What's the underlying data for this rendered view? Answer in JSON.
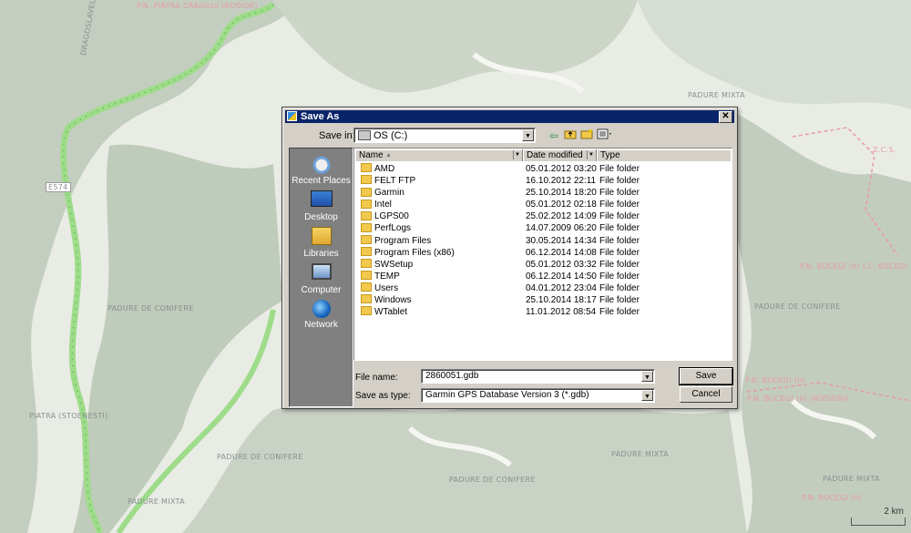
{
  "map": {
    "labels_grey": [
      "DRAGOSLAVELE",
      "E574",
      "PADURE DE CONIFERE",
      "PADURE MIXTA",
      "PADURE DE CONIFERE",
      "PADURE MIXTA",
      "PADURE DE CONIFERE",
      "PADURE MIXTA",
      "PADURE MIXTA",
      "PIATRA (STOENESTI)",
      "PADURE DE CONIFERE"
    ],
    "labels_pink": [
      "P.N. BUCEGI (II) I.C. BUCEGI",
      "P.N. BUCEGI (II)",
      "P.N. BUCEGI (II)",
      "Z.C.S.",
      "P.N. BUCEGI (II) (ROSIORI)",
      "P.N. PIATRA CRAIULUI (ROSIOR)"
    ],
    "scale_label": "2 km"
  },
  "dialog": {
    "title": "Save As",
    "close_label": "✕",
    "save_in_label": "Save in:",
    "save_in_value": "OS (C:)",
    "places": [
      {
        "label": "Recent Places",
        "icon": "recent-places-icon"
      },
      {
        "label": "Desktop",
        "icon": "desktop-icon"
      },
      {
        "label": "Libraries",
        "icon": "libraries-icon"
      },
      {
        "label": "Computer",
        "icon": "computer-icon"
      },
      {
        "label": "Network",
        "icon": "network-icon"
      }
    ],
    "columns": {
      "name": "Name",
      "date": "Date modified",
      "type": "Type"
    },
    "files": [
      {
        "name": "AMD",
        "date": "05.01.2012 03:20",
        "type": "File folder"
      },
      {
        "name": "FELT FTP",
        "date": "16.10.2012 22:11",
        "type": "File folder"
      },
      {
        "name": "Garmin",
        "date": "25.10.2014 18:20",
        "type": "File folder"
      },
      {
        "name": "Intel",
        "date": "05.01.2012 02:18",
        "type": "File folder"
      },
      {
        "name": "LGPS00",
        "date": "25.02.2012 14:09",
        "type": "File folder"
      },
      {
        "name": "PerfLogs",
        "date": "14.07.2009 06:20",
        "type": "File folder"
      },
      {
        "name": "Program Files",
        "date": "30.05.2014 14:34",
        "type": "File folder"
      },
      {
        "name": "Program Files (x86)",
        "date": "06.12.2014 14:08",
        "type": "File folder"
      },
      {
        "name": "SWSetup",
        "date": "05.01.2012 03:32",
        "type": "File folder"
      },
      {
        "name": "TEMP",
        "date": "06.12.2014 14:50",
        "type": "File folder"
      },
      {
        "name": "Users",
        "date": "04.01.2012 23:04",
        "type": "File folder"
      },
      {
        "name": "Windows",
        "date": "25.10.2014 18:17",
        "type": "File folder"
      },
      {
        "name": "WTablet",
        "date": "11.01.2012 08:54",
        "type": "File folder"
      }
    ],
    "file_name_label": "File name:",
    "file_name_value": "2860051.gdb",
    "save_type_label": "Save as type:",
    "save_type_value": "Garmin GPS Database Version 3 (*.gdb)",
    "save_button": "Save",
    "cancel_button": "Cancel"
  }
}
